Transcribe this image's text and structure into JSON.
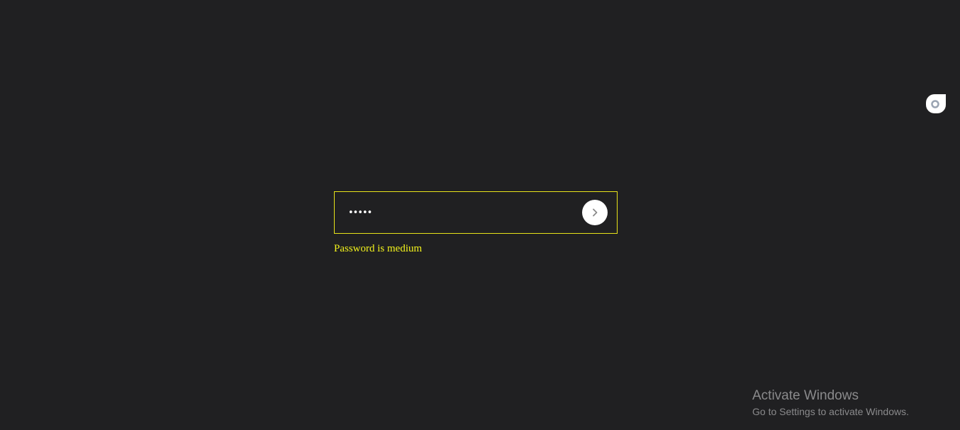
{
  "password_form": {
    "value": "•••••",
    "input_type": "password",
    "border_color": "#e8e41a",
    "submit_icon": "chevron-right-icon"
  },
  "strength_message": {
    "text": "Password is medium",
    "color": "#f2f21c"
  },
  "side_widget": {
    "icon": "ring-icon"
  },
  "watermark": {
    "title": "Activate Windows",
    "subtitle": "Go to Settings to activate Windows."
  },
  "colors": {
    "background": "#202022",
    "accent": "#e8e41a"
  }
}
